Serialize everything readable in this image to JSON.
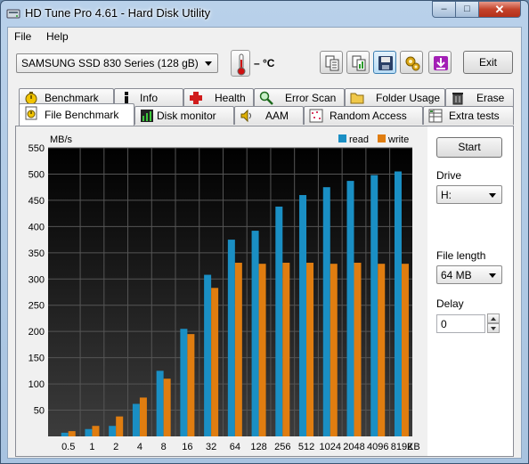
{
  "window": {
    "title": "HD Tune Pro 4.61 - Hard Disk Utility",
    "minimize": "–",
    "maximize": "□",
    "close": "✕"
  },
  "menu": {
    "file": "File",
    "help": "Help"
  },
  "toolbar": {
    "drive": "SAMSUNG SSD 830 Series (128 gB)",
    "temperature": "– °C",
    "exit": "Exit",
    "icons": [
      "copy-text-icon",
      "copy-image-icon",
      "save-icon",
      "options-icon",
      "download-icon"
    ]
  },
  "tabs": {
    "row1": [
      "Benchmark",
      "Info",
      "Health",
      "Error Scan",
      "Folder Usage",
      "Erase"
    ],
    "row2": [
      "File Benchmark",
      "Disk monitor",
      "AAM",
      "Random Access",
      "Extra tests"
    ],
    "active": "File Benchmark"
  },
  "side": {
    "start": "Start",
    "drive_label": "Drive",
    "drive_value": "H:",
    "file_length_label": "File length",
    "file_length_value": "64 MB",
    "delay_label": "Delay",
    "delay_value": "0"
  },
  "chart_data": {
    "type": "bar",
    "ylabel": "MB/s",
    "xunit": "KB",
    "ylim": [
      0,
      550
    ],
    "yticks": [
      50,
      100,
      150,
      200,
      250,
      300,
      350,
      400,
      450,
      500,
      550
    ],
    "categories": [
      "0.5",
      "1",
      "2",
      "4",
      "8",
      "16",
      "32",
      "64",
      "128",
      "256",
      "512",
      "1024",
      "2048",
      "4096",
      "8192"
    ],
    "series": [
      {
        "name": "read",
        "color": "#1a8fc4",
        "values": [
          7,
          14,
          20,
          62,
          125,
          205,
          308,
          375,
          392,
          438,
          460,
          475,
          487,
          498,
          505
        ]
      },
      {
        "name": "write",
        "color": "#e07d10",
        "values": [
          10,
          20,
          38,
          74,
          110,
          195,
          283,
          331,
          329,
          331,
          331,
          329,
          331,
          329,
          329
        ]
      }
    ],
    "grid": true,
    "legend": "top-right"
  }
}
